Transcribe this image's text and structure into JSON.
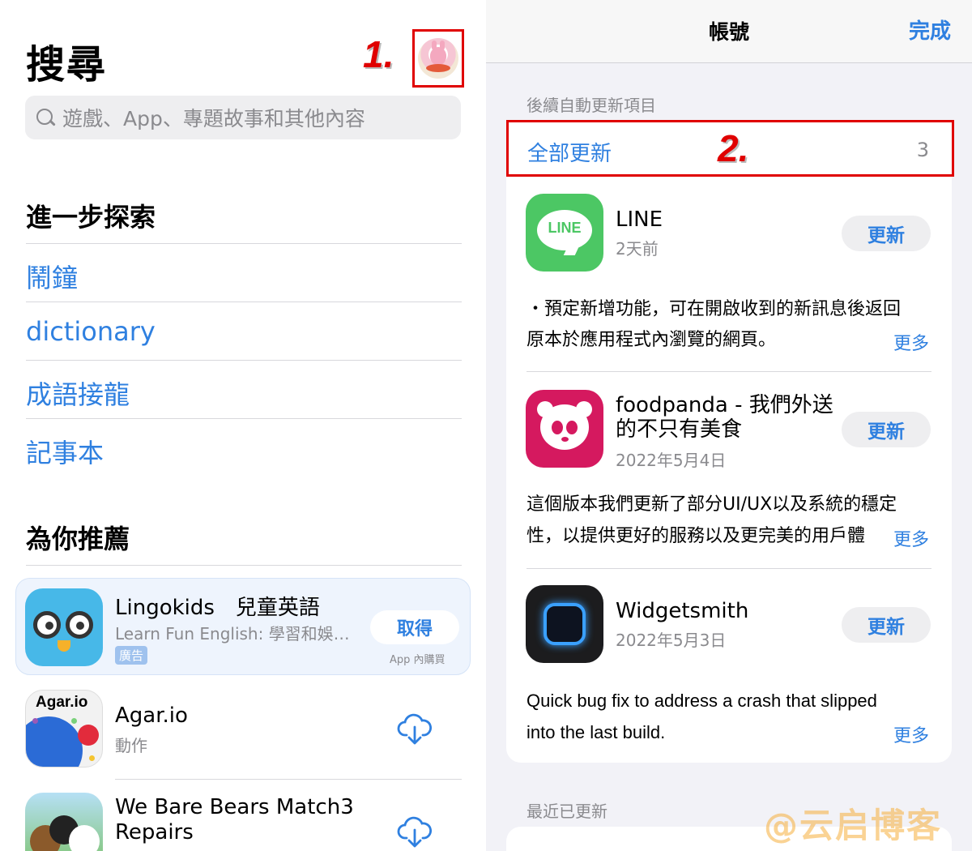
{
  "left": {
    "title": "搜尋",
    "step1": "1.",
    "search_placeholder": "遊戲、App、專題故事和其他內容",
    "explore_title": "進一步探索",
    "explore_links": [
      "鬧鐘",
      "dictionary",
      "成語接龍",
      "記事本"
    ],
    "recommend_title": "為你推薦",
    "ad_app": {
      "name": "Lingokids　兒童英語",
      "subtitle": "Learn Fun English: 學習和娛…",
      "badge": "廣告",
      "button": "取得",
      "iap": "App 內購買"
    },
    "apps": [
      {
        "name": "Agar.io",
        "subtitle": "動作",
        "icon_text": "Agar.io",
        "action_icon": "cloud-download-icon"
      },
      {
        "name": "We Bare Bears Match3\nRepairs",
        "name_line1": "We Bare Bears Match3",
        "name_line2": "Repairs",
        "action_icon": "cloud-download-icon"
      }
    ]
  },
  "right": {
    "nav_title": "帳號",
    "nav_done": "完成",
    "pending_header": "後續自動更新項目",
    "update_all_label": "全部更新",
    "update_all_count": "3",
    "step2": "2.",
    "updates": [
      {
        "name": "LINE",
        "icon_text": "LINE",
        "date": "2天前",
        "button": "更新",
        "notes_line1": "・預定新增功能，可在開啟收到的新訊息後返回",
        "notes_line2": "原本於應用程式內瀏覽的網頁。",
        "more": "更多"
      },
      {
        "name_line1": "foodpanda - 我們外送",
        "name_line2": "的不只有美食",
        "date": "2022年5月4日",
        "button": "更新",
        "notes_line1": "這個版本我們更新了部分UI/UX以及系統的穩定",
        "notes_line2": "性，以提供更好的服務以及更完美的用戶體",
        "more": "更多"
      },
      {
        "name": "Widgetsmith",
        "date": "2022年5月3日",
        "button": "更新",
        "notes_line1": "Quick bug fix to address a crash that slipped",
        "notes_line2": "into the last build.",
        "more": "更多"
      }
    ],
    "recent_header": "最近已更新",
    "watermark": "@云启博客"
  },
  "colors": {
    "accent": "#2f80e0",
    "highlight_box": "#e00000",
    "secondary_text": "#8a8a8e",
    "grouped_bg": "#f2f2f7"
  }
}
